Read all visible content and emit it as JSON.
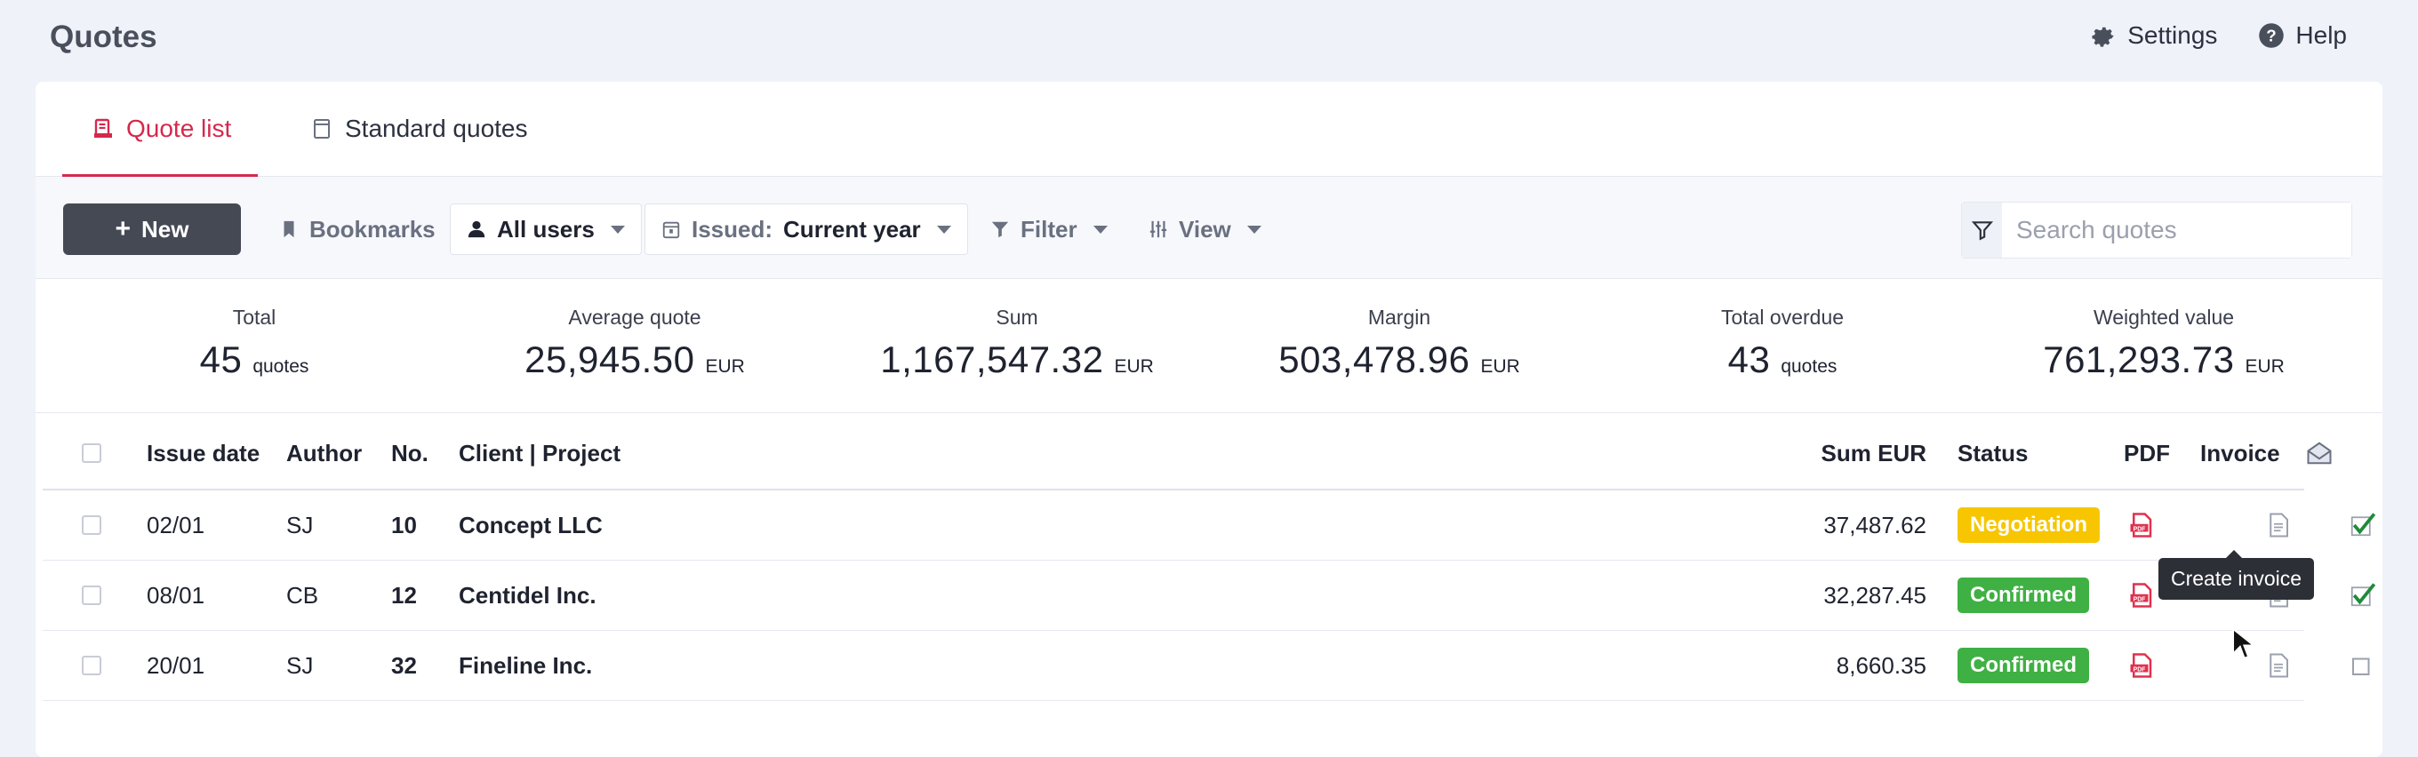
{
  "header": {
    "title": "Quotes",
    "actions": [
      {
        "label": "Settings",
        "icon": "gear-icon"
      },
      {
        "label": "Help",
        "icon": "help-icon"
      }
    ]
  },
  "tabs": [
    {
      "label": "Quote list",
      "icon": "quote-list-icon",
      "active": true
    },
    {
      "label": "Standard quotes",
      "icon": "document-icon",
      "active": false
    }
  ],
  "toolbar": {
    "new_label": "New",
    "bookmarks_label": "Bookmarks",
    "users_label": "All users",
    "issued_label": "Issued:",
    "issued_value": "Current year",
    "filter_label": "Filter",
    "view_label": "View",
    "search_placeholder": "Search quotes"
  },
  "stats": [
    {
      "label": "Total",
      "value": "45",
      "unit": "quotes"
    },
    {
      "label": "Average quote",
      "value": "25,945.50",
      "unit": "EUR"
    },
    {
      "label": "Sum",
      "value": "1,167,547.32",
      "unit": "EUR"
    },
    {
      "label": "Margin",
      "value": "503,478.96",
      "unit": "EUR"
    },
    {
      "label": "Total overdue",
      "value": "43",
      "unit": "quotes"
    },
    {
      "label": "Weighted value",
      "value": "761,293.73",
      "unit": "EUR"
    }
  ],
  "table": {
    "columns": {
      "issue_date": "Issue date",
      "author": "Author",
      "no": "No.",
      "client": "Client | Project",
      "sum": "Sum EUR",
      "status": "Status",
      "pdf": "PDF",
      "invoice": "Invoice"
    },
    "rows": [
      {
        "date": "02/01",
        "author": "SJ",
        "no": "10",
        "client": "Concept LLC",
        "sum": "37,487.62",
        "status": "Negotiation",
        "status_color": "#f7c600",
        "sent": true
      },
      {
        "date": "08/01",
        "author": "CB",
        "no": "12",
        "client": "Centidel Inc.",
        "sum": "32,287.45",
        "status": "Confirmed",
        "status_color": "#3fb043",
        "sent": true
      },
      {
        "date": "20/01",
        "author": "SJ",
        "no": "32",
        "client": "Fineline Inc.",
        "sum": "8,660.35",
        "status": "Confirmed",
        "status_color": "#3fb043",
        "sent": false
      }
    ]
  },
  "tooltip": "Create invoice",
  "colors": {
    "accent": "#d6284d",
    "negotiation": "#f7c600",
    "confirmed": "#3fb043",
    "pdf": "#e0314f",
    "check": "#1f8a3a"
  }
}
